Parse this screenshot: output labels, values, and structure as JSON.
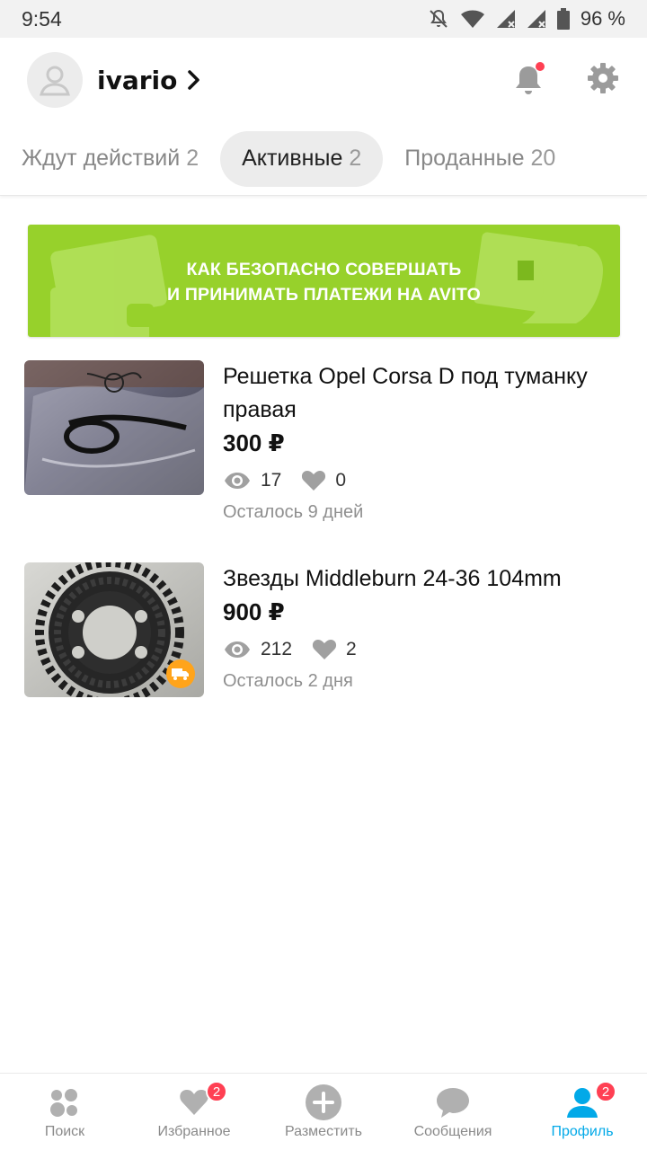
{
  "status_bar": {
    "time": "9:54",
    "battery": "96 %",
    "icons": [
      "notifications-off-icon",
      "wifi-icon",
      "signal-icon",
      "signal-icon",
      "battery-icon"
    ]
  },
  "header": {
    "username": "ivario",
    "notification_dot_color": "#ff4053"
  },
  "tabs": [
    {
      "label": "Ждут действий",
      "count": "2",
      "active": false
    },
    {
      "label": "Активные",
      "count": "2",
      "active": true
    },
    {
      "label": "Проданные",
      "count": "20",
      "active": false
    }
  ],
  "banner": {
    "line1": "КАК БЕЗОПАСНО СОВЕРШАТЬ",
    "line2": "И ПРИНИМАТЬ ПЛАТЕЖИ НА AVITO",
    "color": "#97d12b"
  },
  "listings": [
    {
      "title": "Решетка Opel Corsa D под туманку правая",
      "price": "300 ₽",
      "views": "17",
      "favorites": "0",
      "remaining": "Осталось 9 дней",
      "delivery": false
    },
    {
      "title": "Звезды Middleburn 24-36 104mm",
      "price": "900 ₽",
      "views": "212",
      "favorites": "2",
      "remaining": "Осталось 2 дня",
      "delivery": true
    }
  ],
  "bottom_nav": [
    {
      "label": "Поиск",
      "icon": "search-dots-icon",
      "badge": "",
      "active": false
    },
    {
      "label": "Избранное",
      "icon": "heart-icon",
      "badge": "2",
      "active": false
    },
    {
      "label": "Разместить",
      "icon": "plus-circle-icon",
      "badge": "",
      "active": false
    },
    {
      "label": "Сообщения",
      "icon": "chat-bubble-icon",
      "badge": "",
      "active": false
    },
    {
      "label": "Профиль",
      "icon": "profile-icon",
      "badge": "2",
      "active": true
    }
  ],
  "colors": {
    "accent": "#02a9e8",
    "badge": "#ff4053",
    "delivery_badge": "#ffa41b"
  }
}
